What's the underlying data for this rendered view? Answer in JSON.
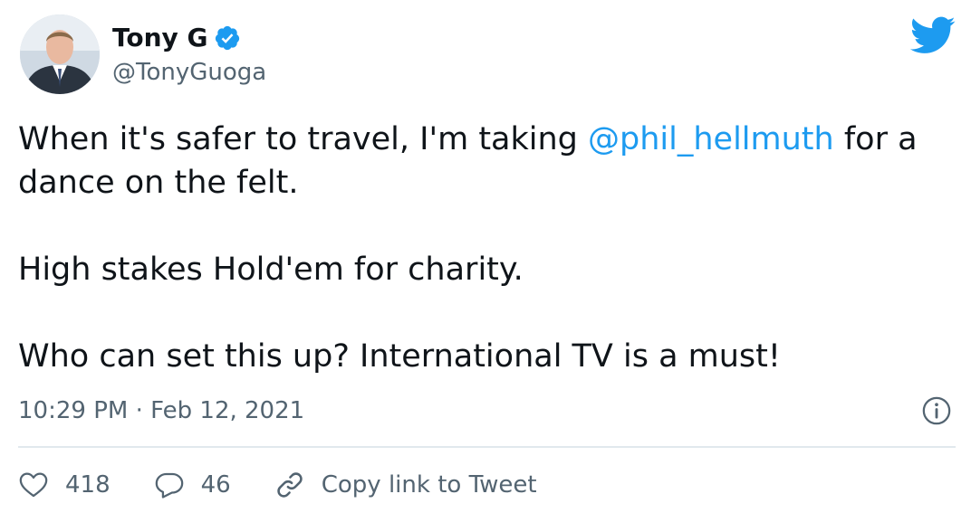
{
  "author": {
    "name": "Tony G",
    "handle": "@TonyGuoga",
    "verified": true
  },
  "tweet": {
    "line1_before": "When it's safer to travel, I'm taking ",
    "mention": "@phil_hellmuth",
    "line1_after": " for a dance on the felt.",
    "paragraph2": "High stakes Hold'em for charity.",
    "paragraph3": "Who can set this up? International TV is a must!"
  },
  "timestamp": "10:29 PM · Feb 12, 2021",
  "actions": {
    "likes": "418",
    "replies": "46",
    "copy_link": "Copy link to Tweet"
  },
  "colors": {
    "accent": "#1d9bf0",
    "text": "#0f1419",
    "secondary": "#536471",
    "divider": "#e1e8ed"
  },
  "icons": [
    "avatar",
    "verified-icon",
    "twitter-bird-icon",
    "info-icon",
    "heart-icon",
    "reply-icon",
    "link-icon"
  ]
}
